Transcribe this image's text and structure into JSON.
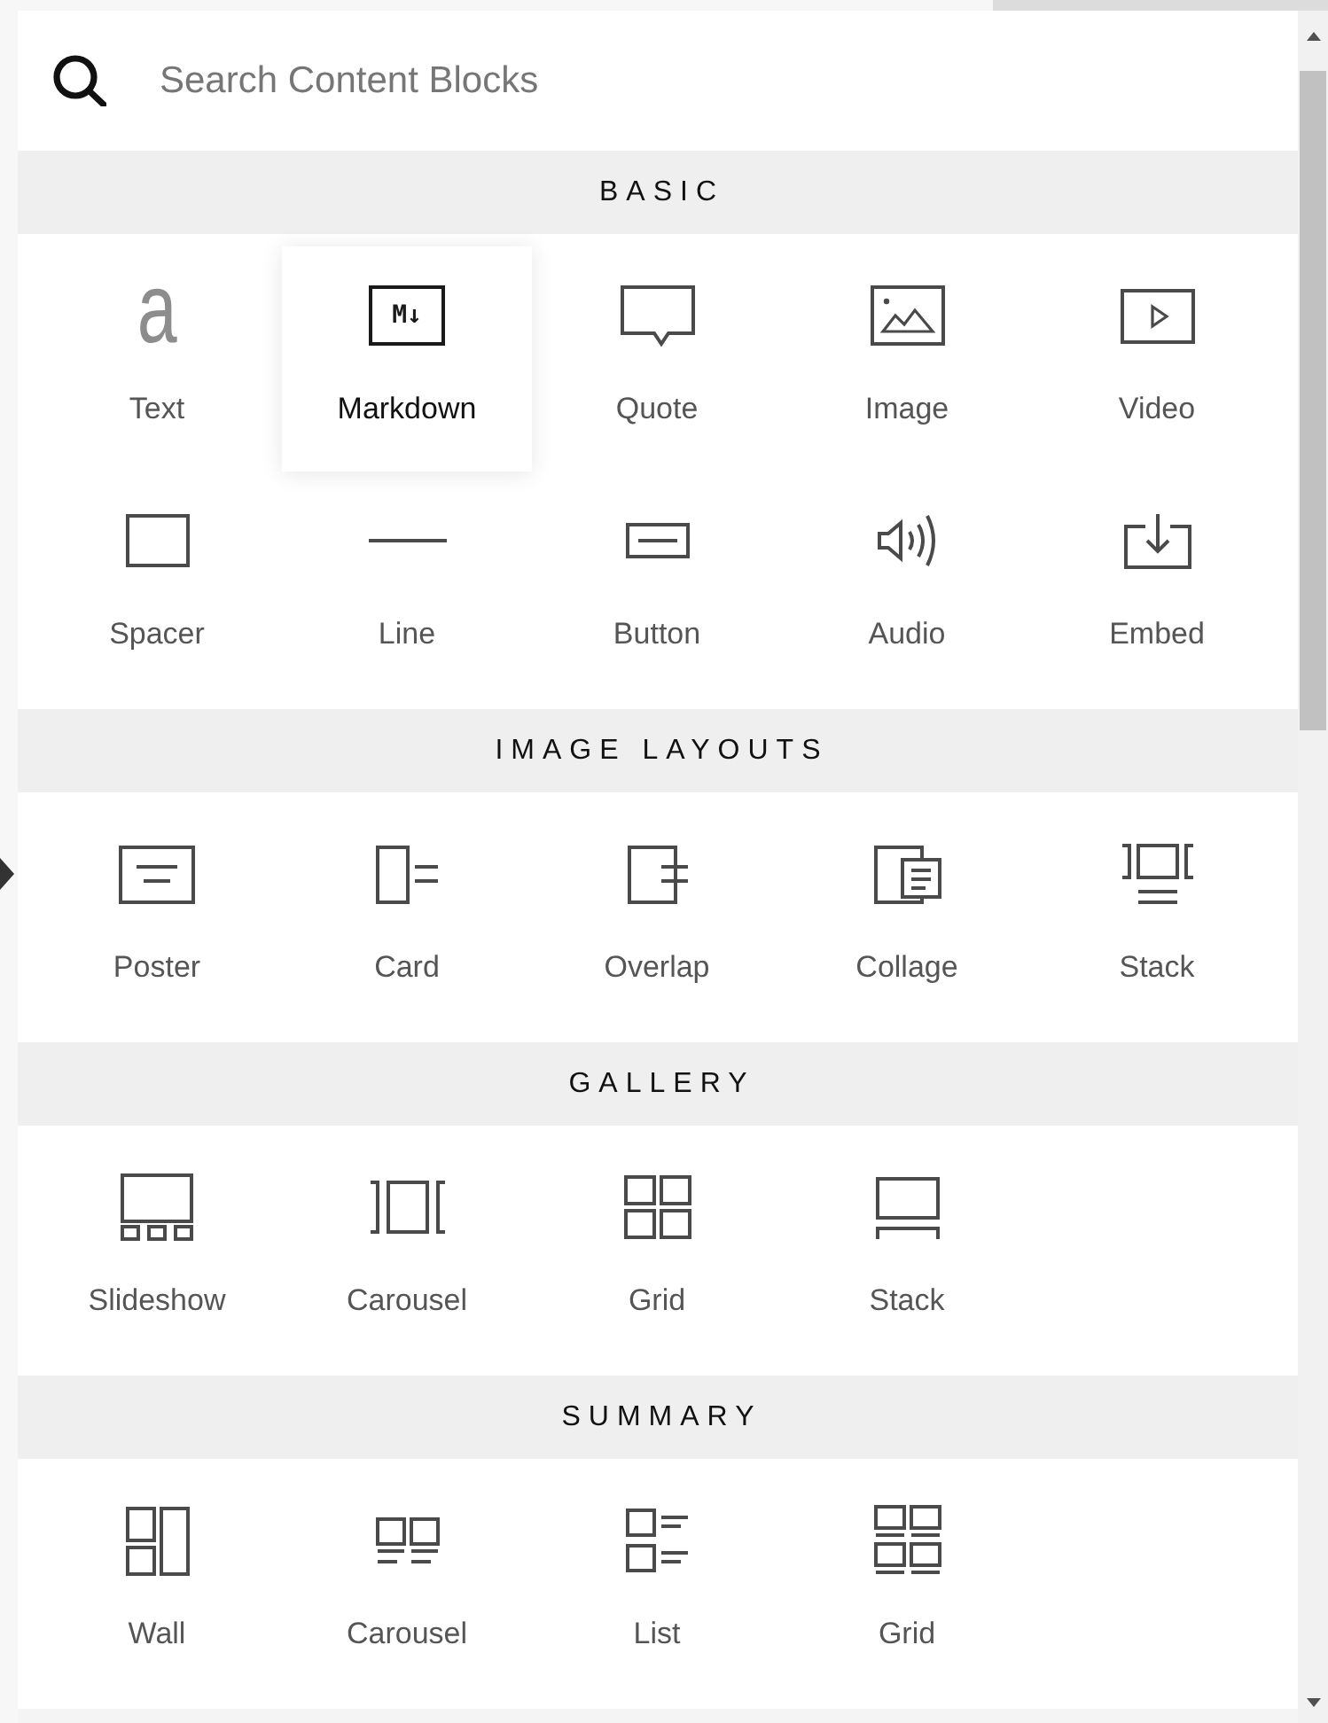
{
  "search": {
    "placeholder": "Search Content Blocks"
  },
  "sections": [
    {
      "title": "BASIC",
      "items": [
        {
          "label": "Text",
          "kind": "letter",
          "glyph": "a",
          "selected": false
        },
        {
          "label": "Markdown",
          "kind": "markdown",
          "glyph": "M↓",
          "selected": true
        },
        {
          "label": "Quote",
          "kind": "bubble",
          "selected": false
        },
        {
          "label": "Image",
          "kind": "picture",
          "selected": false
        },
        {
          "label": "Video",
          "kind": "play",
          "selected": false
        },
        {
          "label": "Spacer",
          "kind": "frame",
          "selected": false
        },
        {
          "label": "Line",
          "kind": "rule",
          "selected": false
        },
        {
          "label": "Button",
          "kind": "button",
          "selected": false
        },
        {
          "label": "Audio",
          "kind": "speaker",
          "selected": false
        },
        {
          "label": "Embed",
          "kind": "download",
          "selected": false
        }
      ]
    },
    {
      "title": "IMAGE LAYOUTS",
      "items": [
        {
          "label": "Poster",
          "kind": "poster",
          "selected": false
        },
        {
          "label": "Card",
          "kind": "card",
          "selected": false
        },
        {
          "label": "Overlap",
          "kind": "overlap",
          "selected": false
        },
        {
          "label": "Collage",
          "kind": "collage",
          "selected": false
        },
        {
          "label": "Stack",
          "kind": "stack",
          "selected": false
        }
      ]
    },
    {
      "title": "GALLERY",
      "items": [
        {
          "label": "Slideshow",
          "kind": "slideshow",
          "selected": false
        },
        {
          "label": "Carousel",
          "kind": "carousel",
          "selected": false
        },
        {
          "label": "Grid",
          "kind": "grid",
          "selected": false
        },
        {
          "label": "Stack",
          "kind": "monitor",
          "selected": false
        }
      ]
    },
    {
      "title": "SUMMARY",
      "items": [
        {
          "label": "Wall",
          "kind": "wall",
          "selected": false
        },
        {
          "label": "Carousel",
          "kind": "cards",
          "selected": false
        },
        {
          "label": "List",
          "kind": "list",
          "selected": false
        },
        {
          "label": "Grid",
          "kind": "tiles",
          "selected": false
        }
      ]
    }
  ]
}
